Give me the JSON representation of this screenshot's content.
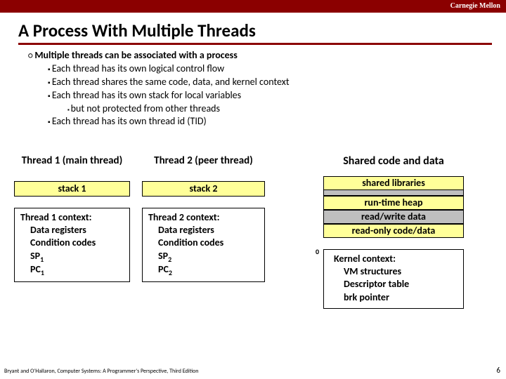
{
  "header": {
    "brand": "Carnegie Mellon"
  },
  "title": "A Process With Multiple Threads",
  "bullets": {
    "main": "Multiple threads can be associated with a process",
    "sub1": "Each thread has its own logical control flow",
    "sub2": "Each thread shares the same code, data, and kernel context",
    "sub3": "Each thread has its own stack for local variables",
    "sub3a": "but not protected from other threads",
    "sub4": "Each thread has its own thread id (TID)"
  },
  "thread1": {
    "heading": "Thread 1 (main thread)",
    "stack": "stack 1",
    "ctx_title": "Thread 1 context:",
    "r1": "Data registers",
    "r2": "Condition codes",
    "sp_label": "SP",
    "sp_sub": "1",
    "pc_label": "PC",
    "pc_sub": "1"
  },
  "thread2": {
    "heading": "Thread 2 (peer thread)",
    "stack": "stack 2",
    "ctx_title": "Thread 2 context:",
    "r1": "Data registers",
    "r2": "Condition codes",
    "sp_label": "SP",
    "sp_sub": "2",
    "pc_label": "PC",
    "pc_sub": "2"
  },
  "shared": {
    "heading": "Shared code and data",
    "lib": "shared libraries",
    "heap": "run-time heap",
    "rw": "read/write data",
    "ro": "read-only code/data",
    "zero": "0",
    "kernel_title": "Kernel context:",
    "k1": "VM structures",
    "k2": "Descriptor table",
    "k3": "brk pointer"
  },
  "footer": {
    "citation": "Bryant and O'Hallaron, Computer Systems: A Programmer's Perspective, Third Edition",
    "page": "6"
  }
}
